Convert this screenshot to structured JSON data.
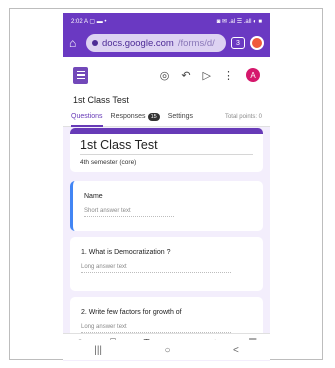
{
  "status": {
    "time": "2:02",
    "left_icons": "A ▢ ▬ •",
    "right_icons": "◙ ✉ .al ☰ .all ◐ ■"
  },
  "browser": {
    "url_main": "docs.google.com",
    "url_rest": "/forms/d/",
    "tab_count": "3"
  },
  "form": {
    "title": "1st Class Test",
    "avatar_letter": "A",
    "tabs": [
      {
        "label": "Questions"
      },
      {
        "label": "Responses",
        "badge": "15"
      },
      {
        "label": "Settings"
      }
    ],
    "total_points": "Total points: 0"
  },
  "cards": {
    "title": "1st  Class Test",
    "description": "4th semester (core)",
    "name_q": {
      "label": "Name",
      "placeholder": "Short answer text"
    },
    "q1": {
      "label": "1. What is Democratization ?",
      "placeholder": "Long answer text"
    },
    "q2": {
      "label": "2. Write few factors for growth of",
      "placeholder": "Long answer text"
    }
  },
  "toolbar": {
    "icons": [
      "add-question-icon",
      "import-icon",
      "title-icon",
      "image-icon",
      "video-icon",
      "section-icon"
    ],
    "glyph_title": "Tт"
  },
  "icons": {
    "recent": "|||",
    "home": "○",
    "back": "<"
  },
  "colors": {
    "accent": "#673ab7",
    "browser_bar": "#6a39c2",
    "avatar": "#d5176c",
    "active_card": "#4285f4"
  }
}
